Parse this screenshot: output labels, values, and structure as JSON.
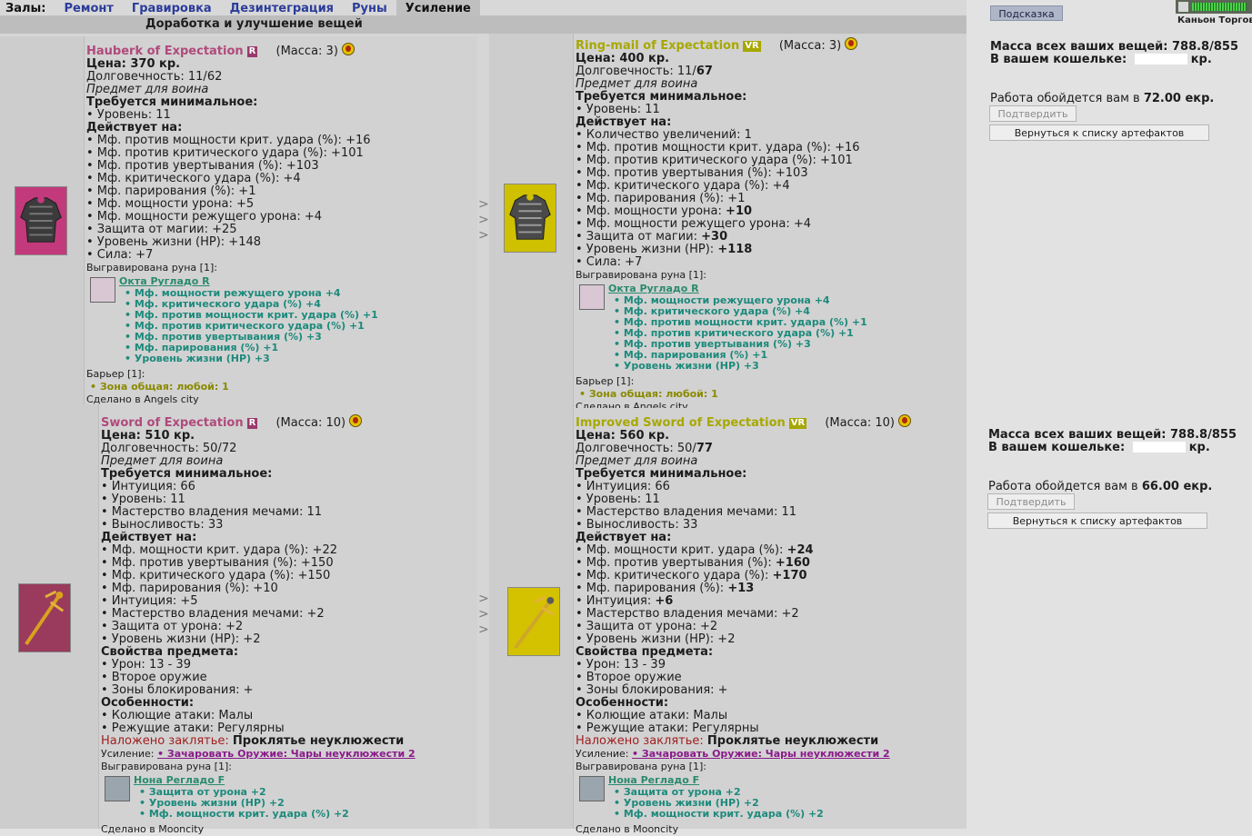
{
  "nav": {
    "lead": "Залы:",
    "tabs": [
      {
        "label": "Ремонт"
      },
      {
        "label": "Гравировка"
      },
      {
        "label": "Дезинтеграция"
      },
      {
        "label": "Руны"
      },
      {
        "label": "Усиление"
      }
    ],
    "active_tab": "Усиление"
  },
  "subtitle": "Доработка и улучшение вещей",
  "colors": {
    "rare": "#b04a7c",
    "very_rare": "#a8a800",
    "rune": "#1c8a7c",
    "link": "#2b3c9a"
  },
  "items": [
    {
      "name": "Hauberk of Expectation",
      "badge": "R",
      "mass": "(Масса: 3)",
      "price_label": "Цена: ",
      "price": "370 кр.",
      "durability_label": "Долговечность: ",
      "durability": "11/62",
      "for_class": "Предмет для воина",
      "req_title": "Требуется минимальное:",
      "req": [
        "• Уровень: 11"
      ],
      "acts_title": "Действует на:",
      "acts": [
        "• Мф. против мощности крит. удара (%): +16",
        "• Мф. против критического удара (%): +101",
        "• Мф. против увертывания (%): +103",
        "• Мф. критического удара (%): +4",
        "• Мф. парирования (%): +1",
        "• Мф. мощности урона: +5",
        "• Мф. мощности режущего урона: +4",
        "• Защита от магии: +25",
        "• Уровень жизни (HP): +148",
        "• Сила: +7"
      ],
      "engraved": "Выгравирована руна [1]:",
      "rune_name": "Окта Ругладо R",
      "rune_lines": [
        "• Мф. мощности режущего урона +4",
        "• Мф. критического удара (%) +4",
        "• Мф. против мощности крит. удара (%) +1",
        "• Мф. против критического удара (%) +1",
        "• Мф. против увертывания (%) +3",
        "• Мф. парирования (%) +1",
        "• Уровень жизни (HP) +3"
      ],
      "barrier": "Барьер [1]:",
      "barrier_zone": "• Зона общая: любой: 1",
      "made": "Сделано в Angels city"
    },
    {
      "name": "Ring-mail of Expectation",
      "badge": "VR",
      "mass": "(Масса: 3)",
      "price_label": "Цена: ",
      "price": "400 кр.",
      "durability_label": "Долговечность: ",
      "durability_a": "11/",
      "durability_b": "67",
      "for_class": "Предмет для воина",
      "req_title": "Требуется минимальное:",
      "req": [
        "• Уровень: 11"
      ],
      "acts_title": "Действует на:",
      "acts": [
        {
          "t": "• Количество увеличений: 1",
          "v": ""
        },
        {
          "t": "• Мф. против мощности крит. удара (%): +16",
          "v": ""
        },
        {
          "t": "• Мф. против критического удара (%): +101",
          "v": ""
        },
        {
          "t": "• Мф. против увертывания (%): +103",
          "v": ""
        },
        {
          "t": "• Мф. критического удара (%): +4",
          "v": ""
        },
        {
          "t": "• Мф. парирования (%): +1",
          "v": ""
        },
        {
          "t": "• Мф. мощности урона: ",
          "v": "+10"
        },
        {
          "t": "• Мф. мощности режущего урона: +4",
          "v": ""
        },
        {
          "t": "• Защита от магии: ",
          "v": "+30"
        },
        {
          "t": "• Уровень жизни (HP): ",
          "v": "+118"
        },
        {
          "t": "• Сила: +7",
          "v": ""
        }
      ],
      "engraved": "Выгравирована руна [1]:",
      "rune_name": "Окта Ругладо R",
      "rune_lines": [
        "• Мф. мощности режущего урона +4",
        "• Мф. критического удара (%) +4",
        "• Мф. против мощности крит. удара (%) +1",
        "• Мф. против критического удара (%) +1",
        "• Мф. против увертывания (%) +3",
        "• Мф. парирования (%) +1",
        "• Уровень жизни (HP) +3"
      ],
      "barrier": "Барьер [1]:",
      "barrier_zone": "• Зона общая: любой: 1",
      "made": "Сделано в Angels city"
    },
    {
      "name": "Sword of Expectation",
      "badge": "R",
      "mass": "(Масса: 10)",
      "price_label": "Цена: ",
      "price": "510 кр.",
      "durability_label": "Долговечность: ",
      "durability": "50/72",
      "for_class": "Предмет для воина",
      "req_title": "Требуется минимальное:",
      "req": [
        "• Интуиция: 66",
        "• Уровень: 11",
        "• Мастерство владения мечами: 11",
        "• Выносливость: 33"
      ],
      "acts_title": "Действует на:",
      "acts": [
        "• Мф. мощности крит. удара (%): +22",
        "• Мф. против увертывания (%): +150",
        "• Мф. критического удара (%): +150",
        "• Мф. парирования (%): +10",
        "• Интуиция: +5",
        "• Мастерство владения мечами: +2",
        "• Защита от урона: +2",
        "• Уровень жизни (HP): +2"
      ],
      "props_title": "Свойства предмета:",
      "props": [
        "• Урон: 13 - 39",
        "• Второе оружие",
        "• Зоны блокирования: +"
      ],
      "feat_title": "Особенности:",
      "feats": [
        "• Колющие атаки: Малы",
        "• Режущие атаки: Регулярны"
      ],
      "spell_label": "Наложено заклятье: ",
      "spell": "Проклятье неуклюжести",
      "enh_label": "Усиление: ",
      "enh_link": "• Зачаровать Оружие: Чары неуклюжести 2",
      "engraved": "Выгравирована руна [1]:",
      "rune_name": "Нона Регладо F",
      "rune_lines": [
        "• Защита от урона +2",
        "• Уровень жизни (HP) +2",
        "• Мф. мощности крит. удара (%) +2"
      ],
      "made": "Сделано в Mooncity"
    },
    {
      "name": "Improved Sword of Expectation",
      "badge": "VR",
      "mass": "(Масса: 10)",
      "price_label": "Цена: ",
      "price": "560 кр.",
      "durability_label": "Долговечность: ",
      "durability_a": "50/",
      "durability_b": "77",
      "for_class": "Предмет для воина",
      "req_title": "Требуется минимальное:",
      "req": [
        "• Интуиция: 66",
        "• Уровень: 11",
        "• Мастерство владения мечами: 11",
        "• Выносливость: 33"
      ],
      "acts_title": "Действует на:",
      "acts": [
        {
          "t": "• Мф. мощности крит. удара (%): ",
          "v": "+24"
        },
        {
          "t": "• Мф. против увертывания (%): ",
          "v": "+160"
        },
        {
          "t": "• Мф. критического удара (%): ",
          "v": "+170"
        },
        {
          "t": "• Мф. парирования (%): ",
          "v": "+13"
        },
        {
          "t": "• Интуиция: ",
          "v": "+6"
        },
        {
          "t": "• Мастерство владения мечами: +2",
          "v": ""
        },
        {
          "t": "• Защита от урона: +2",
          "v": ""
        },
        {
          "t": "• Уровень жизни (HP): +2",
          "v": ""
        }
      ],
      "props_title": "Свойства предмета:",
      "props": [
        "• Урон: 13 - 39",
        "• Второе оружие",
        "• Зоны блокирования: +"
      ],
      "feat_title": "Особенности:",
      "feats": [
        "• Колющие атаки: Малы",
        "• Режущие атаки: Регулярны"
      ],
      "spell_label": "Наложено заклятье: ",
      "spell": "Проклятье неуклюжести",
      "enh_label": "Усиление: ",
      "enh_link": "• Зачаровать Оружие: Чары неуклюжести 2",
      "engraved": "Выгравирована руна [1]:",
      "rune_name": "Нона Регладо F",
      "rune_lines": [
        "• Защита от урона +2",
        "• Уровень жизни (HP) +2",
        "• Мф. мощности крит. удара (%) +2"
      ],
      "made": "Сделано в Mooncity"
    }
  ],
  "arrow": ">",
  "right": {
    "hint": "Подсказка",
    "location": "Каньон Торговцев",
    "sections": [
      {
        "mass_label": "Масса всех ваших вещей: ",
        "mass": "788.8/855",
        "purse_label": "В вашем кошельке: ",
        "purse_unit": "кр.",
        "cost_label": "Работа обойдется вам в ",
        "cost": "72.00 екр.",
        "confirm": "Подтвердить",
        "back": "Вернуться к списку артефактов"
      },
      {
        "mass_label": "Масса всех ваших вещей: ",
        "mass": "788.8/855",
        "purse_label": "В вашем кошельке: ",
        "purse_unit": "кр.",
        "cost_label": "Работа обойдется вам в ",
        "cost": "66.00 екр.",
        "confirm": "Подтвердить",
        "back": "Вернуться к списку артефактов"
      }
    ]
  }
}
